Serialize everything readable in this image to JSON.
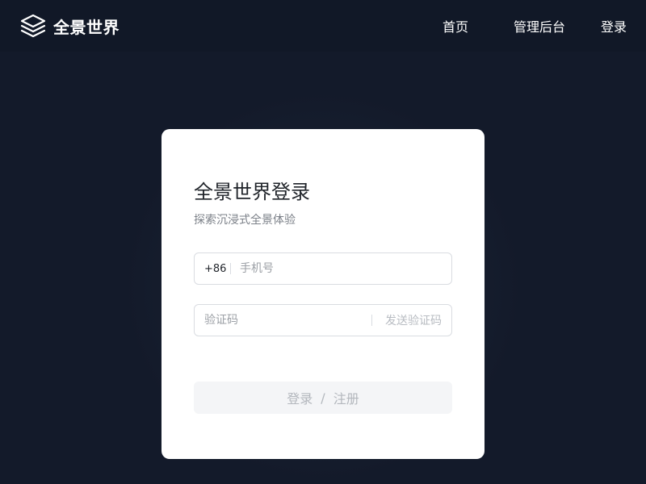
{
  "header": {
    "brand_name": "全景世界",
    "brand_icon": "layers-icon",
    "nav": {
      "home": "首页",
      "admin": "管理后台",
      "login": "登录"
    }
  },
  "login_card": {
    "title": "全景世界登录",
    "subtitle": "探索沉浸式全景体验",
    "phone": {
      "prefix": "+86",
      "placeholder": "手机号",
      "value": ""
    },
    "code": {
      "placeholder": "验证码",
      "value": "",
      "send_label": "发送验证码"
    },
    "submit": {
      "login": "登录",
      "separator": "/",
      "register": "注册"
    }
  },
  "colors": {
    "page_background": "#131a2a",
    "header_background": "#111827",
    "card_background": "#ffffff",
    "button_disabled_background": "#f4f5f7",
    "button_disabled_text": "#b3b7bd"
  }
}
